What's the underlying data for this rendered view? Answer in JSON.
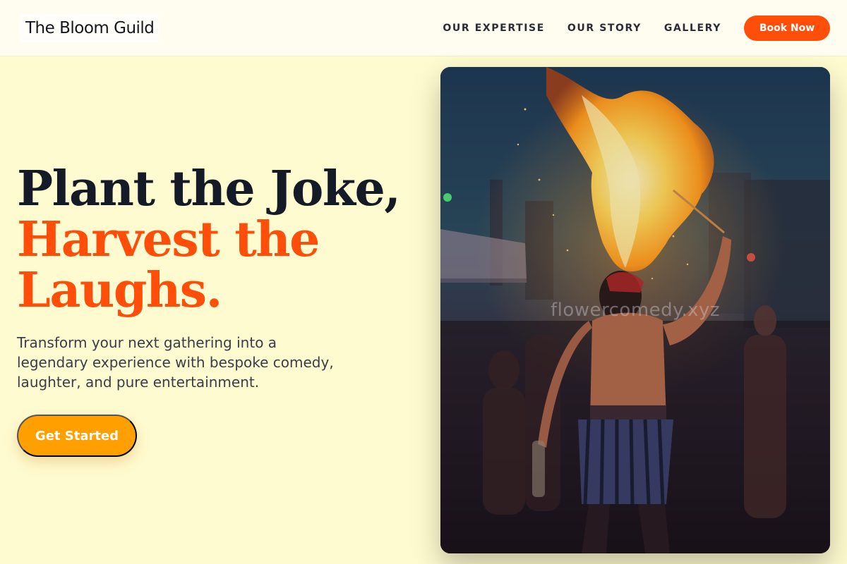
{
  "brand": {
    "name": "The Bloom Guild"
  },
  "nav": {
    "items": [
      "OUR EXPERTISE",
      "OUR STORY",
      "GALLERY"
    ],
    "cta_label": "Book Now"
  },
  "hero": {
    "title_line1": "Plant the Joke,",
    "title_line2": "Harvest the",
    "title_line3": "Laughs.",
    "subtitle": "Transform your next gathering into a legendary experience with bespoke comedy, laughter, and pure entertainment.",
    "cta_label": "Get Started"
  },
  "photo": {
    "subject": "fire-breathing-performer",
    "watermark": "flowercomedy.xyz"
  },
  "colors": {
    "page_bg": "#fffbd0",
    "header_bg": "#fffdf0",
    "accent_orange": "#ff4d0a",
    "cta_amber": "#ffa000",
    "heading_dark": "#141a26"
  }
}
